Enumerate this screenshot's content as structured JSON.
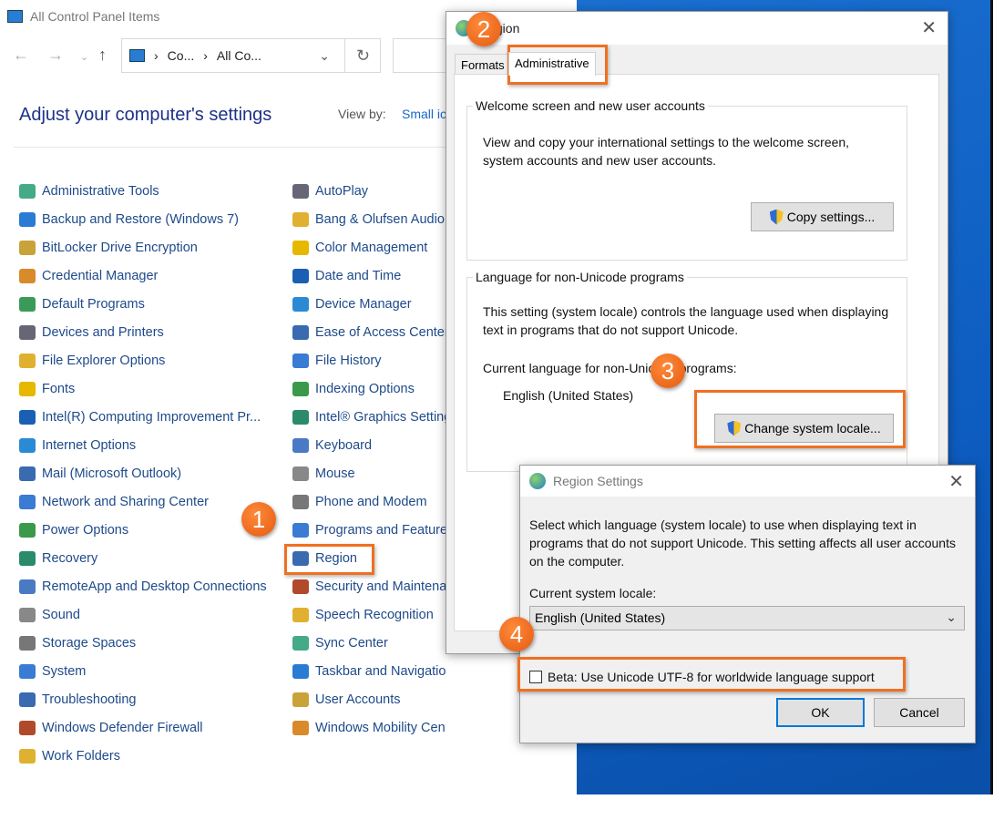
{
  "control_panel": {
    "title": "All Control Panel Items",
    "address": {
      "crumb1": "Co...",
      "crumb2": "All Co..."
    },
    "heading": "Adjust your computer's settings",
    "view_by_label": "View by:",
    "view_by_value": "Small icons",
    "col1": [
      "Administrative Tools",
      "Backup and Restore (Windows 7)",
      "BitLocker Drive Encryption",
      "Credential Manager",
      "Default Programs",
      "Devices and Printers",
      "File Explorer Options",
      "Fonts",
      "Intel(R) Computing Improvement Pr...",
      "Internet Options",
      "Mail (Microsoft Outlook)",
      "Network and Sharing Center",
      "Power Options",
      "Recovery",
      "RemoteApp and Desktop Connections",
      "Sound",
      "Storage Spaces",
      "System",
      "Troubleshooting",
      "Windows Defender Firewall",
      "Work Folders"
    ],
    "col2": [
      "AutoPlay",
      "Bang & Olufsen Audio",
      "Color Management",
      "Date and Time",
      "Device Manager",
      "Ease of Access Center",
      "File History",
      "Indexing Options",
      "Intel® Graphics Settings",
      "Keyboard",
      "Mouse",
      "Phone and Modem",
      "Programs and Features",
      "Region",
      "Security and Maintenance",
      "Speech Recognition",
      "Sync Center",
      "Taskbar and Navigation",
      "User Accounts",
      "Windows Mobility Center"
    ]
  },
  "region_dialog": {
    "title": "Region",
    "tabs": [
      "Formats",
      "Administrative"
    ],
    "active_tab": "Administrative",
    "group1": {
      "legend": "Welcome screen and new user accounts",
      "text": "View and copy your international settings to the welcome screen, system accounts and new user accounts.",
      "button": "Copy settings..."
    },
    "group2": {
      "legend": "Language for non-Unicode programs",
      "text": "This setting (system locale) controls the language used when displaying text in programs that do not support Unicode.",
      "current_label": "Current language for non-Unicode programs:",
      "current_value": "English (United States)",
      "button": "Change system locale..."
    }
  },
  "region_settings": {
    "title": "Region Settings",
    "text": "Select which language (system locale) to use when displaying text in programs that do not support Unicode. This setting affects all user accounts on the computer.",
    "locale_label": "Current system locale:",
    "locale_value": "English (United States)",
    "beta_checkbox": "Beta: Use Unicode UTF-8 for worldwide language support",
    "beta_checked": false,
    "ok": "OK",
    "cancel": "Cancel"
  },
  "annotations": [
    "1",
    "2",
    "3",
    "4"
  ],
  "colors": {
    "accent": "#f07020",
    "link": "#1e4a8a",
    "desktop": "#0d5cc0"
  }
}
